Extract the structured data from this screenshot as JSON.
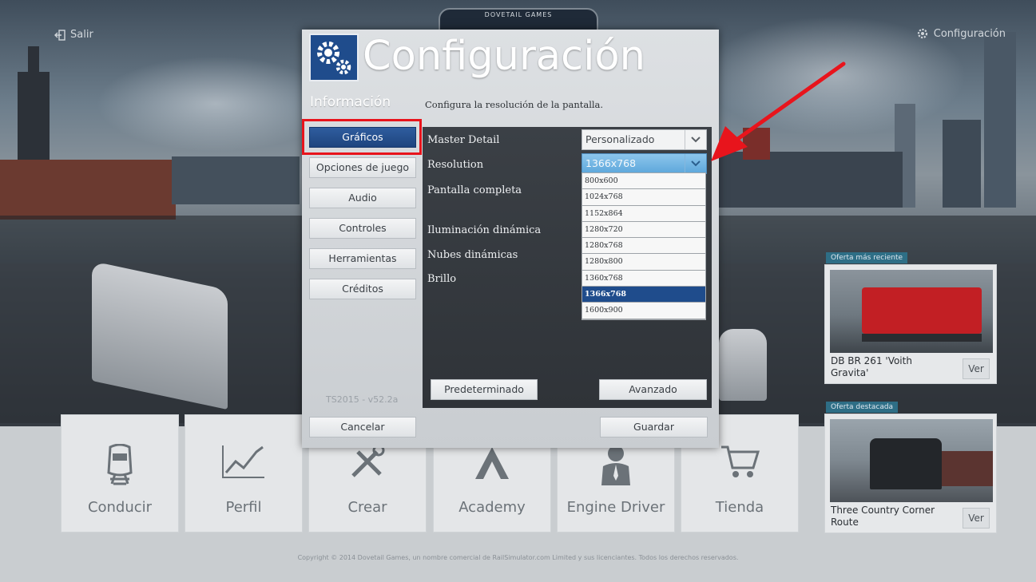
{
  "top": {
    "exit_label": "Salir",
    "config_label": "Configuración",
    "logo_text": "DOVETAIL GAMES"
  },
  "dialog": {
    "title": "Configuración",
    "section": "Información",
    "description": "Configura la resolución de la pantalla.",
    "sidebar": [
      {
        "label": "Gráficos",
        "active": true
      },
      {
        "label": "Opciones de juego",
        "active": false
      },
      {
        "label": "Audio",
        "active": false
      },
      {
        "label": "Controles",
        "active": false
      },
      {
        "label": "Herramientas",
        "active": false
      },
      {
        "label": "Créditos",
        "active": false
      }
    ],
    "version": "TS2015 - v52.2a",
    "settings": [
      {
        "label": "Master Detail"
      },
      {
        "label": "Resolution"
      },
      {
        "label": "Pantalla completa"
      },
      {
        "label": "Iluminación dinámica"
      },
      {
        "label": "Nubes dinámicas"
      },
      {
        "label": "Brillo"
      }
    ],
    "master_detail_value": "Personalizado",
    "resolution_value": "1366x768",
    "resolution_options": [
      "800x600",
      "1024x768",
      "1152x864",
      "1280x720",
      "1280x768",
      "1280x800",
      "1360x768",
      "1366x768",
      "1600x900"
    ],
    "resolution_selected_index": 7,
    "default_button": "Predeterminado",
    "advanced_button": "Avanzado",
    "cancel_button": "Cancelar",
    "save_button": "Guardar"
  },
  "menu": {
    "tiles": [
      {
        "label": "Conducir",
        "icon": "train-front-icon"
      },
      {
        "label": "Perfil",
        "icon": "line-chart-icon"
      },
      {
        "label": "Crear",
        "icon": "tools-icon"
      },
      {
        "label": "Academy",
        "icon": "academy-icon"
      },
      {
        "label": "Engine Driver",
        "icon": "driver-icon"
      },
      {
        "label": "Tienda",
        "icon": "cart-icon"
      }
    ]
  },
  "offers": [
    {
      "tag": "Oferta más reciente",
      "title": "DB BR 261 'Voith Gravita'",
      "button": "Ver"
    },
    {
      "tag": "Oferta destacada",
      "title": "Three Country Corner Route",
      "button": "Ver"
    }
  ],
  "copyright": "Copyright © 2014 Dovetail Games, un nombre comercial de RailSimulator.com Limited y sus licenciantes. Todos los derechos reservados.",
  "colors": {
    "accent_blue": "#1f4c8c",
    "annotation_red": "#e8141c",
    "dropdown_highlight": "#5ea7db"
  }
}
